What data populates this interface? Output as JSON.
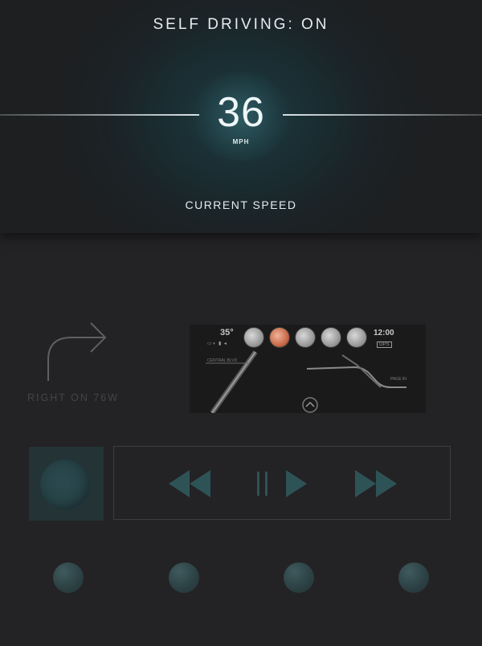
{
  "header": {
    "title": "SELF DRIVING: ON",
    "speed_value": "36",
    "speed_unit": "MPH",
    "speed_caption": "CURRENT SPEED"
  },
  "navigation": {
    "direction_icon": "turn-right-arrow-icon",
    "instruction": "RIGHT ON 76W"
  },
  "dashboard_preview": {
    "temperature": "35°",
    "clock": "12:00",
    "gps_label": "GPS",
    "road_label": "CENTRAL BLVD",
    "page_label": "PAGE IN",
    "app_icons": [
      "app-icon",
      "app-icon",
      "app-icon",
      "app-icon",
      "app-icon"
    ]
  },
  "media": {
    "album_icon": "album-disc-icon",
    "controls": [
      "rewind-icon",
      "play-pause-icon",
      "fast-forward-icon"
    ]
  },
  "quick_buttons": [
    "quick-button",
    "quick-button",
    "quick-button",
    "quick-button"
  ],
  "colors": {
    "background": "#232224",
    "accent": "#2e5357",
    "text": "#e8ecee",
    "muted_text": "#444548"
  }
}
